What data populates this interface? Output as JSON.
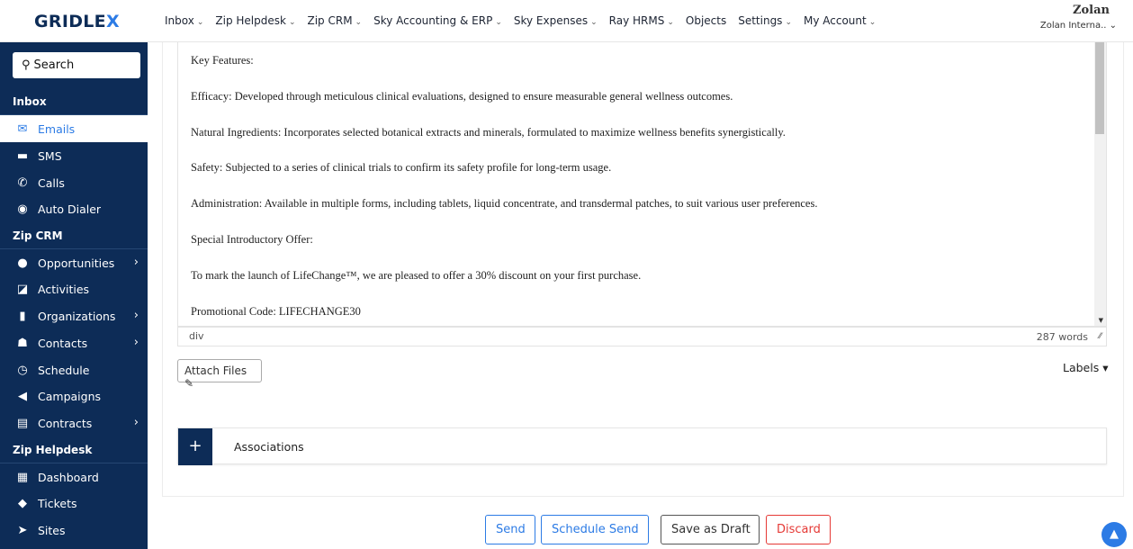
{
  "brand": {
    "logo_main": "GRIDLE",
    "logo_x": "X"
  },
  "nav": [
    {
      "label": "Inbox",
      "chevron": true
    },
    {
      "label": "Zip Helpdesk",
      "chevron": true
    },
    {
      "label": "Zip CRM",
      "chevron": true
    },
    {
      "label": "Sky Accounting & ERP",
      "chevron": true
    },
    {
      "label": "Sky Expenses",
      "chevron": true
    },
    {
      "label": "Ray HRMS",
      "chevron": true
    },
    {
      "label": "Objects",
      "chevron": false
    },
    {
      "label": "Settings",
      "chevron": true
    },
    {
      "label": "My Account",
      "chevron": true
    }
  ],
  "account": {
    "name": "Zolan",
    "org": "Zolan Interna.. ⌄"
  },
  "sidebar": {
    "search_label": "Search",
    "sections": {
      "inbox": "Inbox",
      "zipcrm": "Zip CRM",
      "helpdesk": "Zip Helpdesk"
    },
    "items": [
      {
        "label": "Emails"
      },
      {
        "label": "SMS"
      },
      {
        "label": "Calls"
      },
      {
        "label": "Auto Dialer"
      },
      {
        "label": "Opportunities"
      },
      {
        "label": "Activities"
      },
      {
        "label": "Organizations"
      },
      {
        "label": "Contacts"
      },
      {
        "label": "Schedule"
      },
      {
        "label": "Campaigns"
      },
      {
        "label": "Contracts"
      },
      {
        "label": "Dashboard"
      },
      {
        "label": "Tickets"
      },
      {
        "label": "Sites"
      }
    ]
  },
  "editor": {
    "lines": [
      "Key Features:",
      "Efficacy: Developed through meticulous clinical evaluations, designed to ensure measurable general wellness outcomes.",
      "Natural Ingredients: Incorporates selected botanical extracts and minerals, formulated to maximize wellness benefits synergistically.",
      "Safety: Subjected to a series of clinical trials to confirm its safety profile for long-term usage.",
      "Administration: Available in multiple forms, including tablets, liquid concentrate, and transdermal patches, to suit various user preferences.",
      "Special Introductory Offer:",
      "To mark the launch of LifeChange™, we are pleased to offer a 30% discount on your first purchase.",
      "Promotional Code: LIFECHANGE30"
    ],
    "status_path": "div",
    "word_count": "287 words"
  },
  "attach_label": "Attach Files",
  "labels_label": "Labels ▾",
  "associations_label": "Associations",
  "buttons": {
    "send": "Send",
    "schedule": "Schedule Send",
    "draft": "Save as Draft",
    "discard": "Discard"
  }
}
